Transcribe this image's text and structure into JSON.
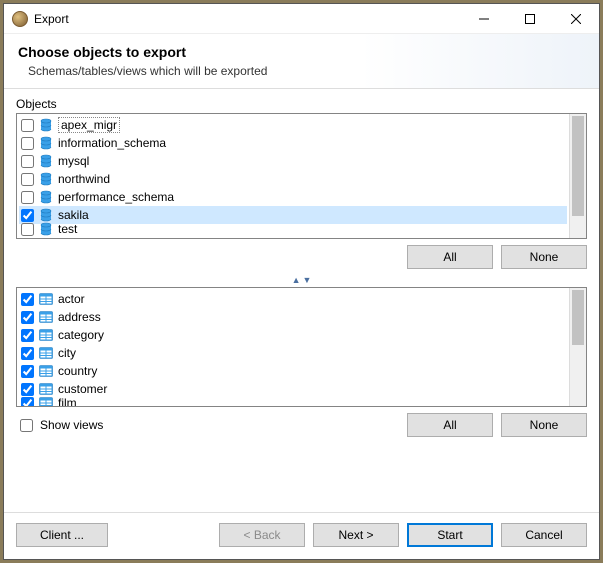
{
  "window": {
    "title": "Export",
    "heading": "Choose objects to export",
    "subheading": "Schemas/tables/views which will be exported"
  },
  "objects_label": "Objects",
  "schemas": [
    {
      "name": "apex_migr",
      "checked": false,
      "selected": false,
      "focused": true
    },
    {
      "name": "information_schema",
      "checked": false,
      "selected": false
    },
    {
      "name": "mysql",
      "checked": false,
      "selected": false
    },
    {
      "name": "northwind",
      "checked": false,
      "selected": false
    },
    {
      "name": "performance_schema",
      "checked": false,
      "selected": false
    },
    {
      "name": "sakila",
      "checked": true,
      "selected": true
    },
    {
      "name": "test",
      "checked": false,
      "selected": false,
      "partial": true
    }
  ],
  "tables": [
    {
      "name": "actor",
      "checked": true
    },
    {
      "name": "address",
      "checked": true
    },
    {
      "name": "category",
      "checked": true
    },
    {
      "name": "city",
      "checked": true
    },
    {
      "name": "country",
      "checked": true
    },
    {
      "name": "customer",
      "checked": true
    },
    {
      "name": "film",
      "checked": true,
      "partial": true
    }
  ],
  "buttons": {
    "all": "All",
    "none": "None",
    "show_views": "Show views",
    "client": "Client ...",
    "back": "< Back",
    "next": "Next >",
    "start": "Start",
    "cancel": "Cancel"
  },
  "show_views_checked": false
}
